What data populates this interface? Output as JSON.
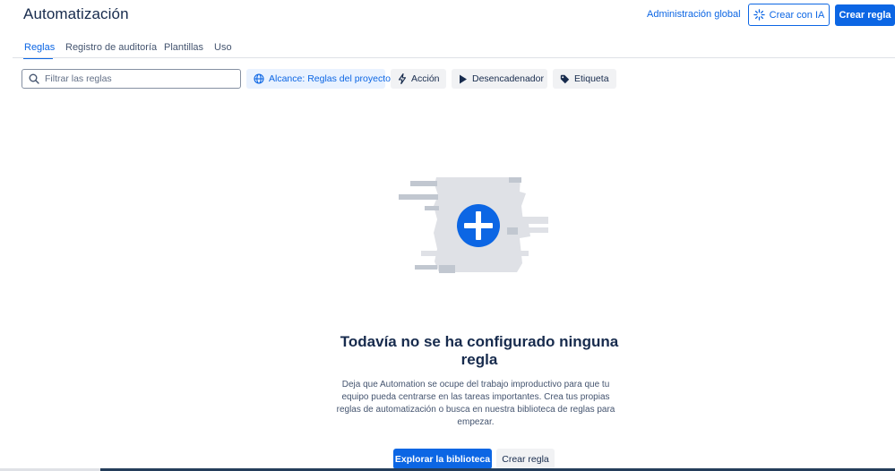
{
  "header": {
    "title": "Automatización",
    "global_admin_link": "Administración global",
    "create_ai_button": "Crear con IA",
    "create_rule_button": "Crear regla"
  },
  "tabs": [
    {
      "label": "Reglas",
      "active": true
    },
    {
      "label": "Registro de auditoría",
      "active": false
    },
    {
      "label": "Plantillas",
      "active": false
    },
    {
      "label": "Uso",
      "active": false
    }
  ],
  "filters": {
    "search_placeholder": "Filtrar las reglas",
    "search_value": "",
    "scope": "Alcance: Reglas del proyecto",
    "action": "Acción",
    "trigger": "Desencadenador",
    "label": "Etiqueta"
  },
  "empty_state": {
    "title": "Todavía no se ha configurado ninguna regla",
    "description": "Deja que Automation se ocupe del trabajo improductivo para que tu equipo pueda centrarse en las tareas importantes. Crea tus propias reglas de automatización o busca en nuestra biblioteca de reglas para empezar.",
    "explore_button": "Explorar la biblioteca",
    "create_button": "Crear regla",
    "illustration_icon": "plus-circle-icon"
  },
  "colors": {
    "accent": "#0c66e4",
    "text": "#172b4d",
    "subtle_text": "#44546f",
    "neutral_bg": "#f1f2f4"
  }
}
